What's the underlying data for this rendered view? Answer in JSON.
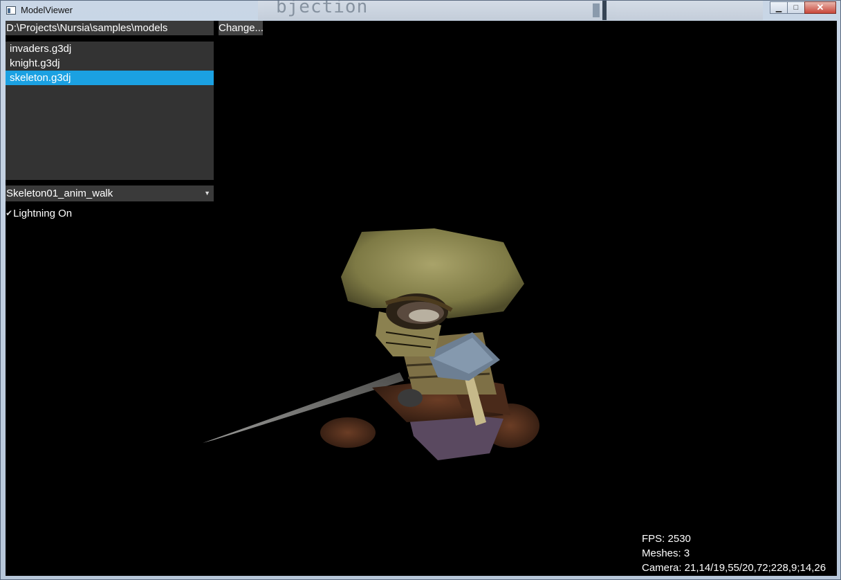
{
  "window": {
    "title": "ModelViewer",
    "background_text": "bjection",
    "buttons": {
      "minimize": "▁",
      "maximize": "□",
      "close": "✕"
    }
  },
  "browser": {
    "path": "D:\\Projects\\Nursia\\samples\\models",
    "change_label": "Change...",
    "files": [
      "invaders.g3dj",
      "knight.g3dj",
      "skeleton.g3dj"
    ],
    "selected_file": "skeleton.g3dj"
  },
  "animation": {
    "selected": "Skeleton01_anim_walk"
  },
  "lighting": {
    "label": "Lightning On",
    "checked": true
  },
  "stats": {
    "fps": "FPS: 2530",
    "meshes": "Meshes: 3",
    "camera": "Camera: 21,14/19,55/20,72;228,9;14,26"
  },
  "colors": {
    "selection": "#1ba1e2",
    "panel": "#333333",
    "viewport": "#000000"
  }
}
